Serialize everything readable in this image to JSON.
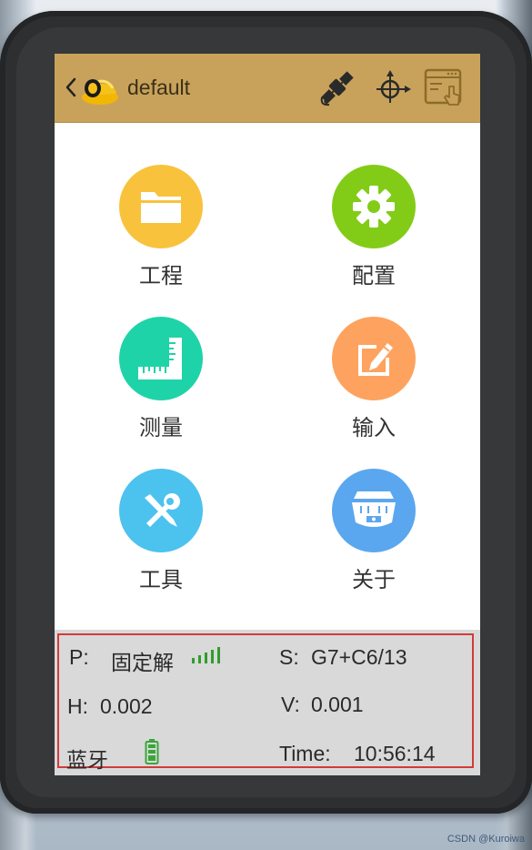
{
  "header": {
    "project_name": "default"
  },
  "menu": [
    {
      "label": "工程",
      "icon": "folder-icon",
      "color": "#f9c23c"
    },
    {
      "label": "配置",
      "icon": "gear-icon",
      "color": "#82cc18"
    },
    {
      "label": "测量",
      "icon": "ruler-icon",
      "color": "#1fd3a8"
    },
    {
      "label": "输入",
      "icon": "edit-icon",
      "color": "#fda35f"
    },
    {
      "label": "工具",
      "icon": "tools-icon",
      "color": "#4cc2ef"
    },
    {
      "label": "关于",
      "icon": "receiver-icon",
      "color": "#5aa7ef"
    }
  ],
  "status": {
    "p_label": "P:",
    "p_value": "固定解",
    "s_label": "S:",
    "s_value": "G7+C6/13",
    "h_label": "H:",
    "h_value": "0.002",
    "v_label": "V:",
    "v_value": "0.001",
    "bt_label": "蓝牙",
    "time_label": "Time:",
    "time_value": "10:56:14"
  },
  "watermark": "CSDN @Kuroiwa",
  "colors": {
    "topbar": "#c8a25b",
    "signal": "#2e9e2e",
    "battery": "#3aa63a",
    "frame": "#d33a3a"
  }
}
